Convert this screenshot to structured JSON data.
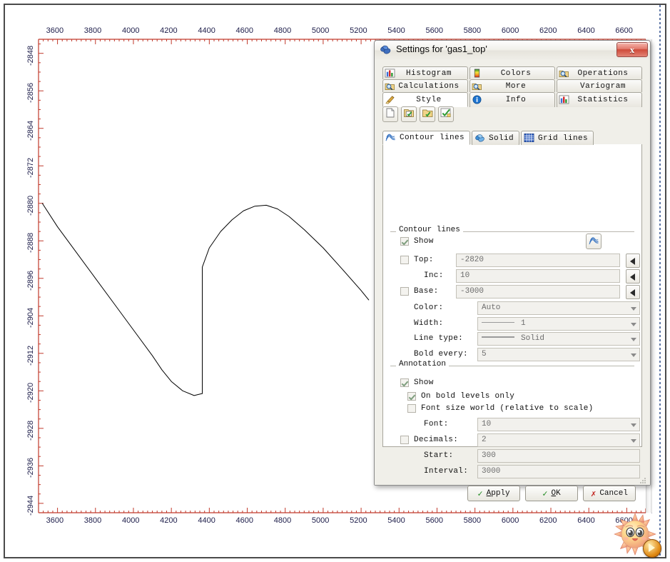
{
  "window": {
    "title": "Settings for 'gas1_top'",
    "close_label": "x",
    "title_icon": "settings-blob-icon"
  },
  "tab_rows": [
    [
      {
        "label": "Histogram",
        "icon": "histogram-icon",
        "active": false
      },
      {
        "label": "Colors",
        "icon": "color-ramp-icon",
        "active": false
      },
      {
        "label": "Operations",
        "icon": "magnifier-folder-icon",
        "active": false
      }
    ],
    [
      {
        "label": "Calculations",
        "icon": "magnifier-folder-icon",
        "active": false
      },
      {
        "label": "More",
        "icon": "magnifier-folder-icon",
        "active": false
      },
      {
        "label": "Variogram",
        "icon": "none",
        "active": false
      }
    ],
    [
      {
        "label": "Style",
        "icon": "paintbrush-icon",
        "active": true
      },
      {
        "label": "Info",
        "icon": "info-icon",
        "active": false
      },
      {
        "label": "Statistics",
        "icon": "histogram-icon",
        "active": false
      }
    ]
  ],
  "toolbar": [
    {
      "name": "new-document-button",
      "icon": "blank-page-icon"
    },
    {
      "name": "save-settings-button",
      "icon": "save-check-icon"
    },
    {
      "name": "load-settings-button",
      "icon": "folder-check-icon"
    },
    {
      "name": "apply-settings-button",
      "icon": "check-apply-icon"
    }
  ],
  "panel_tabs": [
    {
      "label": "Contour lines",
      "icon": "contour-lines-icon",
      "active": true
    },
    {
      "label": "Solid",
      "icon": "solid-fill-icon",
      "active": false
    },
    {
      "label": "Grid lines",
      "icon": "grid-lines-icon",
      "active": false
    }
  ],
  "contour_group": {
    "title": "Contour lines",
    "show": {
      "label": "Show",
      "checked": true
    },
    "preview_icon": "contour-lines-icon",
    "fields": [
      {
        "label": "Top:",
        "value": "-2820",
        "checkbox": true,
        "checked": false,
        "spinner": true
      },
      {
        "label": "Inc:",
        "value": "10",
        "checkbox": false,
        "checked": false,
        "spinner": true
      },
      {
        "label": "Base:",
        "value": "-3000",
        "checkbox": true,
        "checked": false,
        "spinner": true
      }
    ],
    "combos": [
      {
        "label": "Color:",
        "value": "Auto",
        "preview": "none"
      },
      {
        "label": "Width:",
        "value": "1",
        "preview": "thin-line"
      },
      {
        "label": "Line type:",
        "value": "Solid",
        "preview": "thick-line"
      },
      {
        "label": "Bold every:",
        "value": "5",
        "preview": "none"
      }
    ]
  },
  "annotation_group": {
    "title": "Annotation",
    "checks": [
      {
        "label": "Show",
        "checked": true
      },
      {
        "label": "On bold levels only",
        "checked": true
      },
      {
        "label": "Font size world (relative to scale)",
        "checked": false
      }
    ],
    "font": {
      "label": "Font:",
      "value": "10",
      "combo": true,
      "checkbox": false,
      "checked": false
    },
    "decimals": {
      "label": "Decimals:",
      "value": "2",
      "combo": true,
      "checkbox": true,
      "checked": false
    },
    "start": {
      "label": "Start:",
      "value": "300",
      "combo": false
    },
    "interval": {
      "label": "Interval:",
      "value": "3000",
      "combo": false
    }
  },
  "buttons": [
    {
      "name": "apply-button",
      "label": "Apply",
      "icon": "green-check-icon"
    },
    {
      "name": "ok-button",
      "label": "OK",
      "icon": "green-check-icon"
    },
    {
      "name": "cancel-button",
      "label": "Cancel",
      "icon": "red-x-icon"
    }
  ],
  "chart_data": {
    "type": "line",
    "title": "",
    "xlabel": "",
    "ylabel": "",
    "axis_color": "#c0392b",
    "line_color": "#000000",
    "grid": false,
    "xlim": [
      3500,
      6700
    ],
    "ylim": [
      -2946,
      -2845
    ],
    "x_ticks": [
      3600,
      3800,
      4000,
      4200,
      4400,
      4600,
      4800,
      5000,
      5200,
      5400,
      5600,
      5800,
      6000,
      6200,
      6400,
      6600
    ],
    "y_ticks": [
      -2848,
      -2856,
      -2864,
      -2872,
      -2880,
      -2888,
      -2896,
      -2904,
      -2912,
      -2920,
      -2928,
      -2936,
      -2944
    ],
    "series": [
      {
        "name": "gas1_top",
        "x": [
          3520,
          3600,
          3700,
          3800,
          3900,
          4000,
          4100,
          4150,
          4200,
          4260,
          4320,
          4360,
          4363,
          4363,
          4400,
          4460,
          4520,
          4580,
          4640,
          4700,
          4760,
          4820,
          4900,
          5000,
          5100,
          5200,
          5240
        ],
        "y": [
          -2880.0,
          -2885.0,
          -2890.5,
          -2896.0,
          -2901.5,
          -2907.0,
          -2912.5,
          -2915.5,
          -2918.0,
          -2920.0,
          -2921.0,
          -2920.6,
          -2920.6,
          -2893.6,
          -2889.5,
          -2886.0,
          -2883.5,
          -2881.6,
          -2880.6,
          -2880.4,
          -2881.2,
          -2882.8,
          -2885.6,
          -2889.5,
          -2894.0,
          -2898.6,
          -2900.6
        ]
      }
    ],
    "notes": "Depth structure profile with a vertical fault step near x=4363"
  },
  "mascot": {
    "name": "sun-smiley-mascot",
    "badge": "play-badge-icon"
  }
}
